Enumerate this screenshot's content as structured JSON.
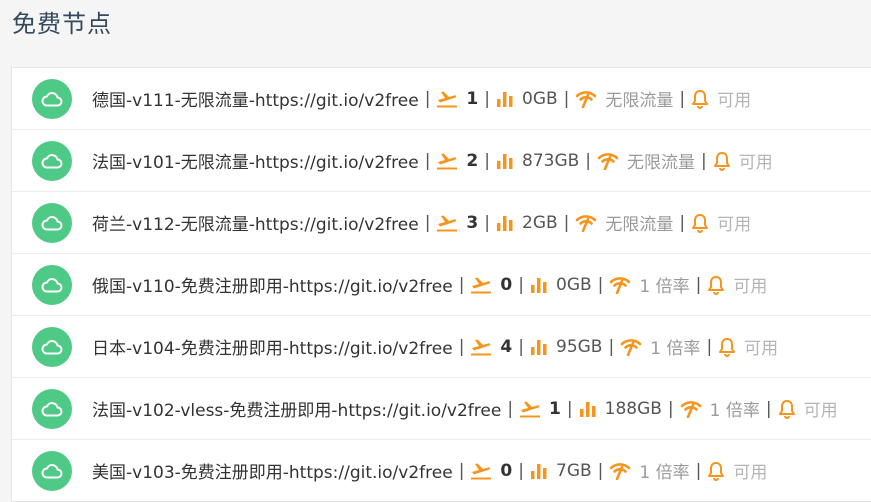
{
  "page": {
    "title": "免费节点"
  },
  "colors": {
    "accent": "#f7941d",
    "cloud": "#4fc986"
  },
  "icons": {
    "cloud": "cloud-icon",
    "online": "airplane-takeoff-icon",
    "traffic": "bar-chart-icon",
    "rate": "signal-icon",
    "status": "bell-icon"
  },
  "nodes": [
    {
      "name": "德国-v111-无限流量-https://git.io/v2free",
      "online": "1",
      "traffic": "0GB",
      "rate": "无限流量",
      "status": "可用"
    },
    {
      "name": "法国-v101-无限流量-https://git.io/v2free",
      "online": "2",
      "traffic": "873GB",
      "rate": "无限流量",
      "status": "可用"
    },
    {
      "name": "荷兰-v112-无限流量-https://git.io/v2free",
      "online": "3",
      "traffic": "2GB",
      "rate": "无限流量",
      "status": "可用"
    },
    {
      "name": "俄国-v110-免费注册即用-https://git.io/v2free",
      "online": "0",
      "traffic": "0GB",
      "rate": "1 倍率",
      "status": "可用"
    },
    {
      "name": "日本-v104-免费注册即用-https://git.io/v2free",
      "online": "4",
      "traffic": "95GB",
      "rate": "1 倍率",
      "status": "可用"
    },
    {
      "name": "法国-v102-vless-免费注册即用-https://git.io/v2free",
      "online": "1",
      "traffic": "188GB",
      "rate": "1 倍率",
      "status": "可用"
    },
    {
      "name": "美国-v103-免费注册即用-https://git.io/v2free",
      "online": "0",
      "traffic": "7GB",
      "rate": "1 倍率",
      "status": "可用"
    }
  ],
  "separator": "|"
}
